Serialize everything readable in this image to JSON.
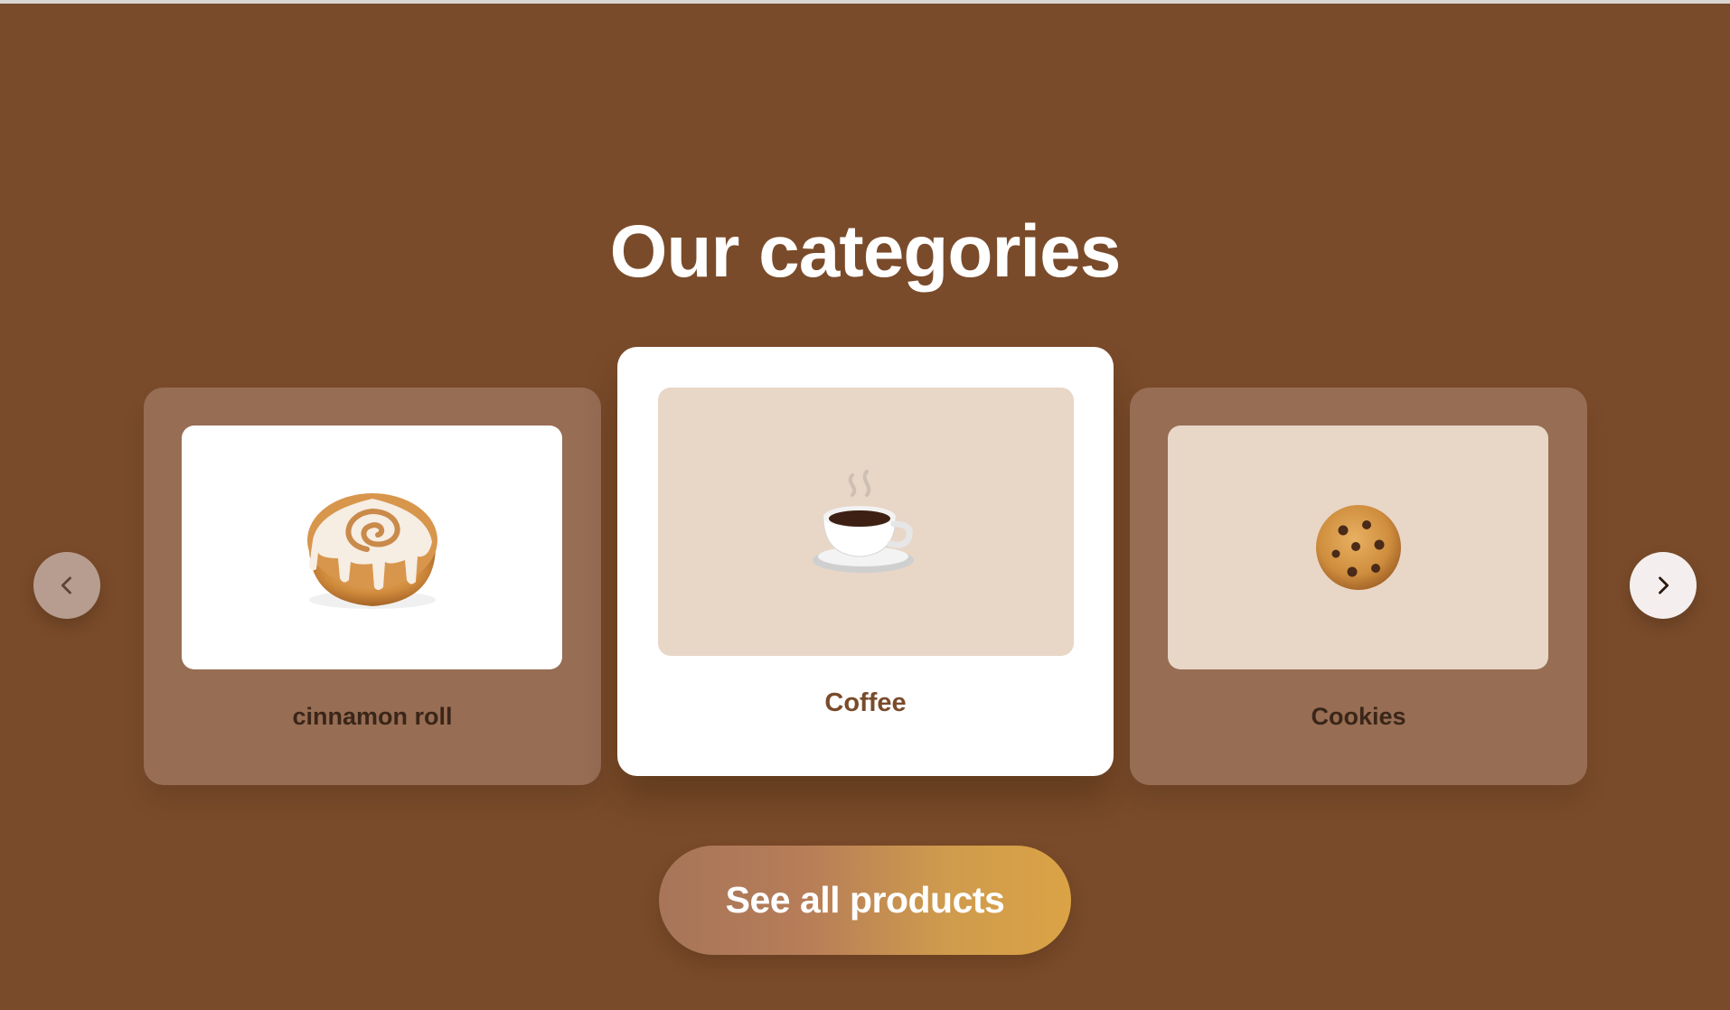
{
  "section": {
    "title": "Our categories"
  },
  "carousel": {
    "prev_icon": "chevron-left-icon",
    "next_icon": "chevron-right-icon",
    "items": [
      {
        "label": "cinnamon roll",
        "image": "cinnamon-roll-image",
        "state": "side",
        "media_color": "#ffffff"
      },
      {
        "label": "Coffee",
        "image": "coffee-cup-image",
        "state": "active",
        "media_color": "#e8d6c7"
      },
      {
        "label": "Cookies",
        "image": "cookie-image",
        "state": "side",
        "media_color": "#e8d6c7"
      }
    ]
  },
  "cta": {
    "label": "See all products"
  },
  "colors": {
    "background": "#7a4b2a",
    "side_card": "#976d54",
    "active_card": "#ffffff",
    "cta_gradient_start": "#a7755a",
    "cta_gradient_end": "#dba345"
  }
}
